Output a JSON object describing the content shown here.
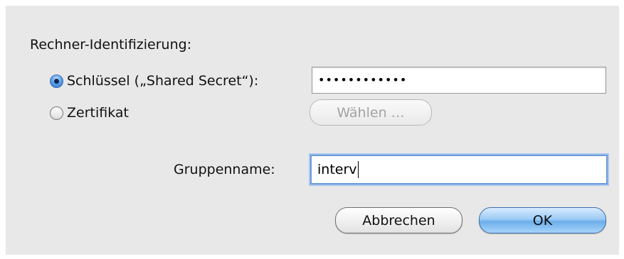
{
  "dialog": {
    "section_label": "Rechner-Identifizierung:",
    "options": [
      {
        "label": "Schlüssel („Shared Secret“):",
        "selected": true
      },
      {
        "label": "Zertifikat",
        "selected": false
      }
    ],
    "secret_value": "••••••••••••",
    "choose_button_label": "Wählen …",
    "group_label": "Gruppenname:",
    "group_value": "interv",
    "cancel_label": "Abbrechen",
    "ok_label": "OK"
  }
}
